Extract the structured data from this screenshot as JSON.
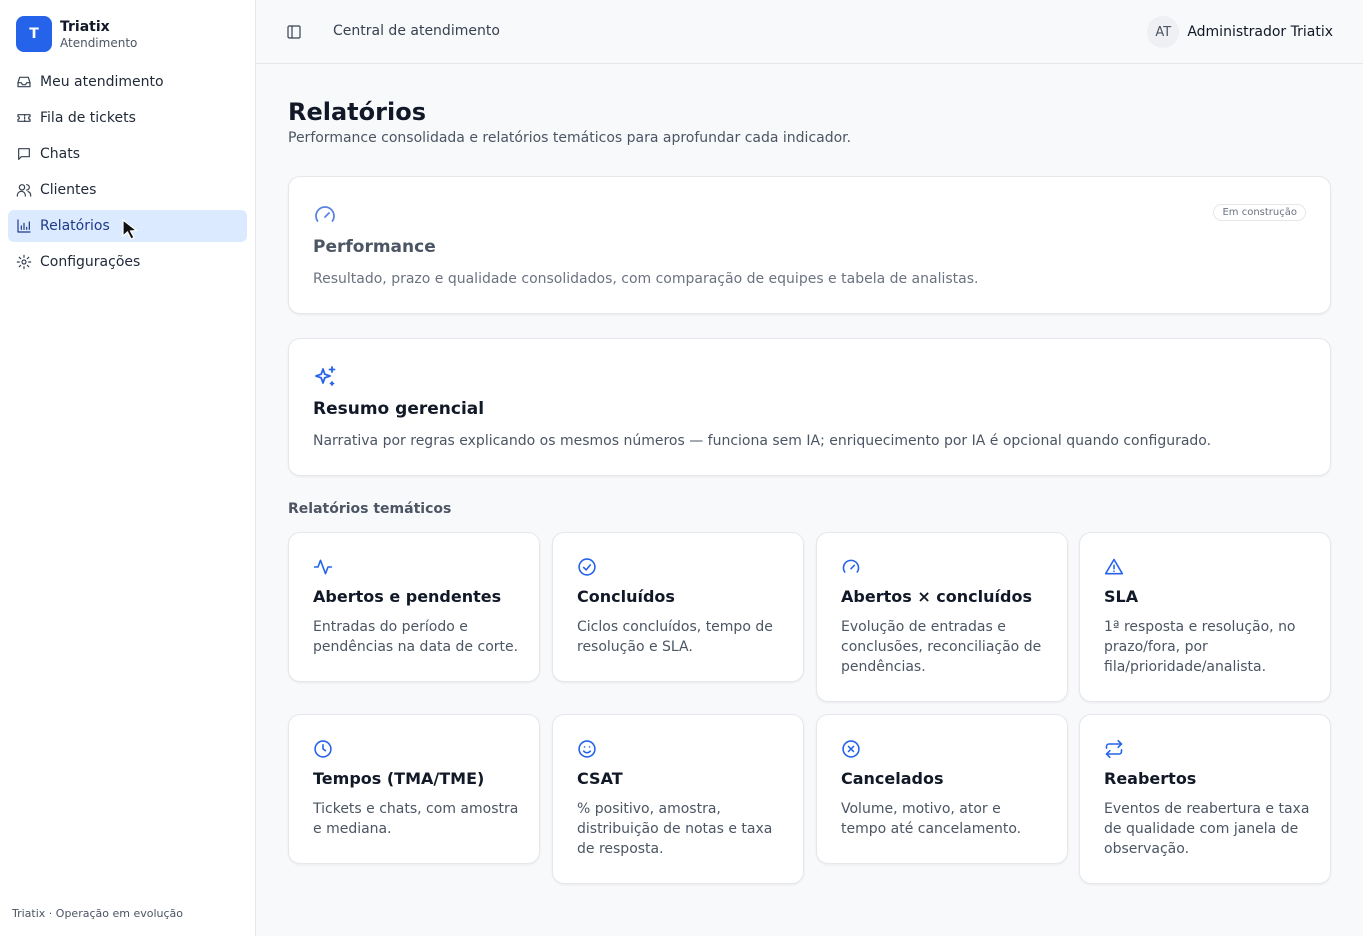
{
  "brand": {
    "initial": "T",
    "name": "Triatix",
    "subtitle": "Atendimento"
  },
  "sidebar": {
    "items": [
      {
        "label": "Meu atendimento",
        "icon": "inbox-icon"
      },
      {
        "label": "Fila de tickets",
        "icon": "ticket-icon"
      },
      {
        "label": "Chats",
        "icon": "message-icon"
      },
      {
        "label": "Clientes",
        "icon": "users-icon"
      },
      {
        "label": "Relatórios",
        "icon": "bar-chart-icon",
        "active": true
      },
      {
        "label": "Configurações",
        "icon": "gear-icon"
      }
    ],
    "footer": "Triatix · Operação em evolução"
  },
  "topbar": {
    "title": "Central de atendimento",
    "user_initials": "AT",
    "user_name": "Administrador Triatix"
  },
  "page": {
    "title": "Relatórios",
    "description": "Performance consolidada e relatórios temáticos para aprofundar cada indicador."
  },
  "performance": {
    "title": "Performance",
    "badge": "Em construção",
    "description": "Resultado, prazo e qualidade consolidados, com comparação de equipes e tabela de analistas."
  },
  "summary": {
    "title": "Resumo gerencial",
    "description": "Narrativa por regras explicando os mesmos números — funciona sem IA; enriquecimento por IA é opcional quando configurado."
  },
  "thematic": {
    "section_title": "Relatórios temáticos",
    "cards": [
      {
        "title": "Abertos e pendentes",
        "description": "Entradas do período e pendências na data de corte.",
        "icon": "activity-icon"
      },
      {
        "title": "Concluídos",
        "description": "Ciclos concluídos, tempo de resolução e SLA.",
        "icon": "check-circle-icon"
      },
      {
        "title": "Abertos × concluídos",
        "description": "Evolução de entradas e conclusões, reconciliação de pendências.",
        "icon": "gauge-icon"
      },
      {
        "title": "SLA",
        "description": "1ª resposta e resolução, no prazo/fora, por fila/prioridade/analista.",
        "icon": "warning-icon"
      },
      {
        "title": "Tempos (TMA/TME)",
        "description": "Tickets e chats, com amostra e mediana.",
        "icon": "clock-icon"
      },
      {
        "title": "CSAT",
        "description": "% positivo, amostra, distribuição de notas e taxa de resposta.",
        "icon": "smile-icon"
      },
      {
        "title": "Cancelados",
        "description": "Volume, motivo, ator e tempo até cancelamento.",
        "icon": "x-circle-icon"
      },
      {
        "title": "Reabertos",
        "description": "Eventos de reabertura e taxa de qualidade com janela de observação.",
        "icon": "repeat-icon"
      }
    ]
  },
  "colors": {
    "accent": "#2563eb",
    "active_bg": "#dbeafe"
  }
}
